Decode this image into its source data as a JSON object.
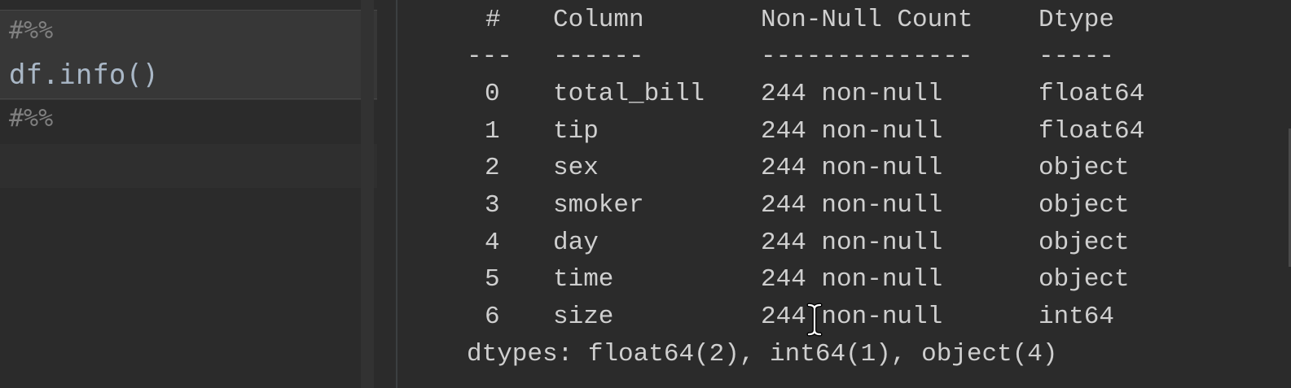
{
  "editor": {
    "cell_marker": "#%%",
    "code_line": "df.info()",
    "cell_marker_2": "#%%"
  },
  "output": {
    "header": {
      "num": "#",
      "column": "Column",
      "non_null": "Non-Null Count",
      "dtype": "Dtype"
    },
    "separator": {
      "num": "---",
      "column": "------",
      "non_null": "--------------",
      "dtype": "-----"
    },
    "rows": [
      {
        "num": "0",
        "column": "total_bill",
        "count": "244 non-null",
        "dtype": "float64"
      },
      {
        "num": "1",
        "column": "tip",
        "count": "244 non-null",
        "dtype": "float64"
      },
      {
        "num": "2",
        "column": "sex",
        "count": "244 non-null",
        "dtype": "object"
      },
      {
        "num": "3",
        "column": "smoker",
        "count": "244 non-null",
        "dtype": "object"
      },
      {
        "num": "4",
        "column": "day",
        "count": "244 non-null",
        "dtype": "object"
      },
      {
        "num": "5",
        "column": "time",
        "count": "244 non-null",
        "dtype": "object"
      },
      {
        "num": "6",
        "column": "size",
        "count": "244 non-null",
        "dtype": "int64"
      }
    ],
    "dtypes_summary": "dtypes: float64(2), int64(1), object(4)"
  },
  "icons": {
    "cursor": "text-cursor-icon"
  }
}
